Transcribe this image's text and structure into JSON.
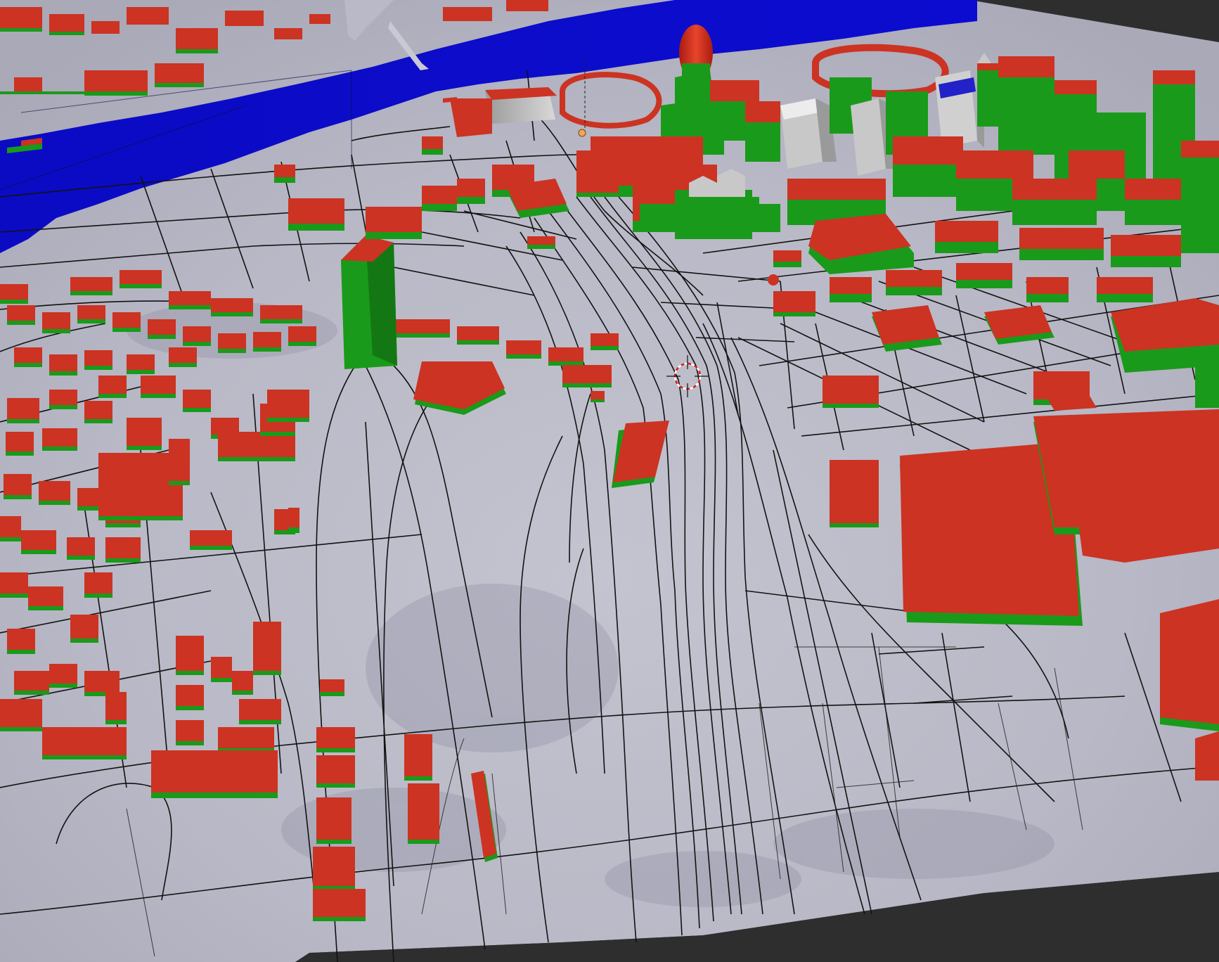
{
  "viewport": {
    "label": "",
    "status": ""
  },
  "colors": {
    "background": "#4a4a4a",
    "terrain": "#b9b9c7",
    "terrain_shadow": "#9e9fb0",
    "terrain_light": "#d0d0d8",
    "river": "#0a0ac8",
    "roof": "#cc3322",
    "wall": "#1a9a1a",
    "wall_dark": "#137813",
    "road": "#111111",
    "gray_building": "#c8c8c8",
    "cursor_red": "#d81e1e"
  },
  "icons": {
    "cursor": "3d-cursor-icon",
    "camera": "camera-icon",
    "light": "light-icon"
  }
}
